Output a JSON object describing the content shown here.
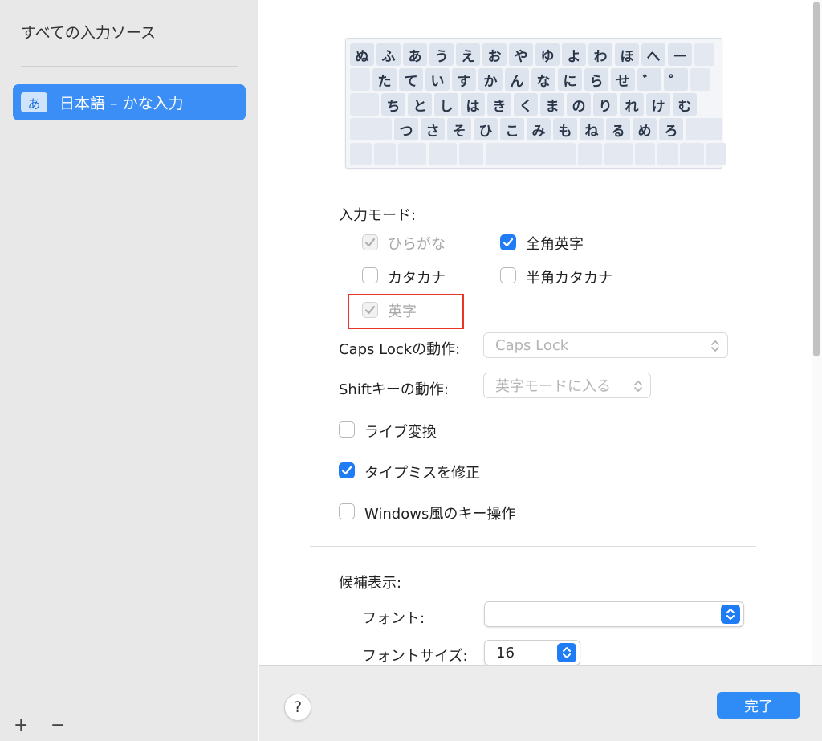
{
  "sidebar": {
    "title": "すべての入力ソース",
    "items": [
      {
        "icon_text": "あ",
        "label": "日本語 – かな入力",
        "selected": true
      }
    ],
    "add_label": "+",
    "remove_label": "−"
  },
  "keyboard": {
    "rows": [
      [
        "ぬ",
        "ふ",
        "あ",
        "う",
        "え",
        "お",
        "や",
        "ゆ",
        "よ",
        "わ",
        "ほ",
        "へ",
        "ー"
      ],
      [
        "た",
        "て",
        "い",
        "す",
        "か",
        "ん",
        "な",
        "に",
        "ら",
        "せ",
        "゛",
        "゜"
      ],
      [
        "ち",
        "と",
        "し",
        "は",
        "き",
        "く",
        "ま",
        "の",
        "り",
        "れ",
        "け",
        "む"
      ],
      [
        "つ",
        "さ",
        "そ",
        "ひ",
        "こ",
        "み",
        "も",
        "ね",
        "る",
        "め",
        "ろ"
      ]
    ]
  },
  "input_modes": {
    "heading": "入力モード:",
    "hiragana": {
      "label": "ひらがな",
      "checked": true,
      "disabled": true
    },
    "katakana": {
      "label": "カタカナ",
      "checked": false,
      "disabled": false
    },
    "eiji": {
      "label": "英字",
      "checked": true,
      "disabled": true
    },
    "zenkaku_eiji": {
      "label": "全角英字",
      "checked": true,
      "disabled": false
    },
    "hankaku_katakana": {
      "label": "半角カタカナ",
      "checked": false,
      "disabled": false
    }
  },
  "caps_lock": {
    "label": "Caps Lockの動作:",
    "value": "Caps Lock"
  },
  "shift": {
    "label": "Shiftキーの動作:",
    "value": "英字モードに入る"
  },
  "options": {
    "live_conversion": {
      "label": "ライブ変換",
      "checked": false
    },
    "typo_fix": {
      "label": "タイプミスを修正",
      "checked": true
    },
    "windows_keys": {
      "label": "Windows風のキー操作",
      "checked": false
    }
  },
  "candidates": {
    "heading": "候補表示:",
    "font_label": "フォント:",
    "font_value": "",
    "font_size_label": "フォントサイズ:",
    "font_size_value": "16"
  },
  "footer": {
    "help_label": "?",
    "done_label": "完了"
  },
  "colors": {
    "accent": "#1f7cf4",
    "selection": "#3a8ef5",
    "highlight_box": "#e53629"
  }
}
